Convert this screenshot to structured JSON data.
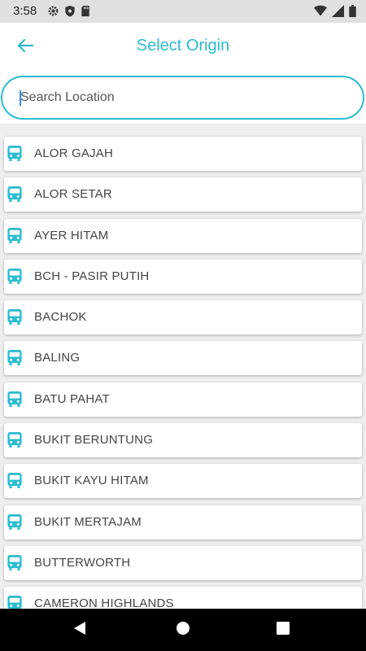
{
  "status_bar": {
    "time": "3:58",
    "left_icons": [
      "gear-icon",
      "shield-icon",
      "sd-card-icon"
    ],
    "right_icons": [
      "wifi-icon",
      "signal-icon",
      "battery-icon"
    ]
  },
  "app_bar": {
    "title": "Select Origin",
    "back_icon": "arrow-left-icon"
  },
  "search": {
    "placeholder": "Search Location",
    "value": ""
  },
  "locations": [
    "ALOR GAJAH",
    "ALOR SETAR",
    "AYER HITAM",
    "BCH - PASIR PUTIH",
    "BACHOK",
    "BALING",
    "BATU PAHAT",
    "BUKIT BERUNTUNG",
    "BUKIT KAYU HITAM",
    "BUKIT MERTAJAM",
    "BUTTERWORTH",
    "CAMERON HIGHLANDS"
  ],
  "colors": {
    "accent": "#2cbcd1",
    "status_bar": "#e0e0e0",
    "list_background": "#eeeeee",
    "nav_bar": "#000000"
  },
  "nav_bar": {
    "icons": [
      "back-triangle-icon",
      "home-circle-icon",
      "recents-square-icon"
    ]
  }
}
